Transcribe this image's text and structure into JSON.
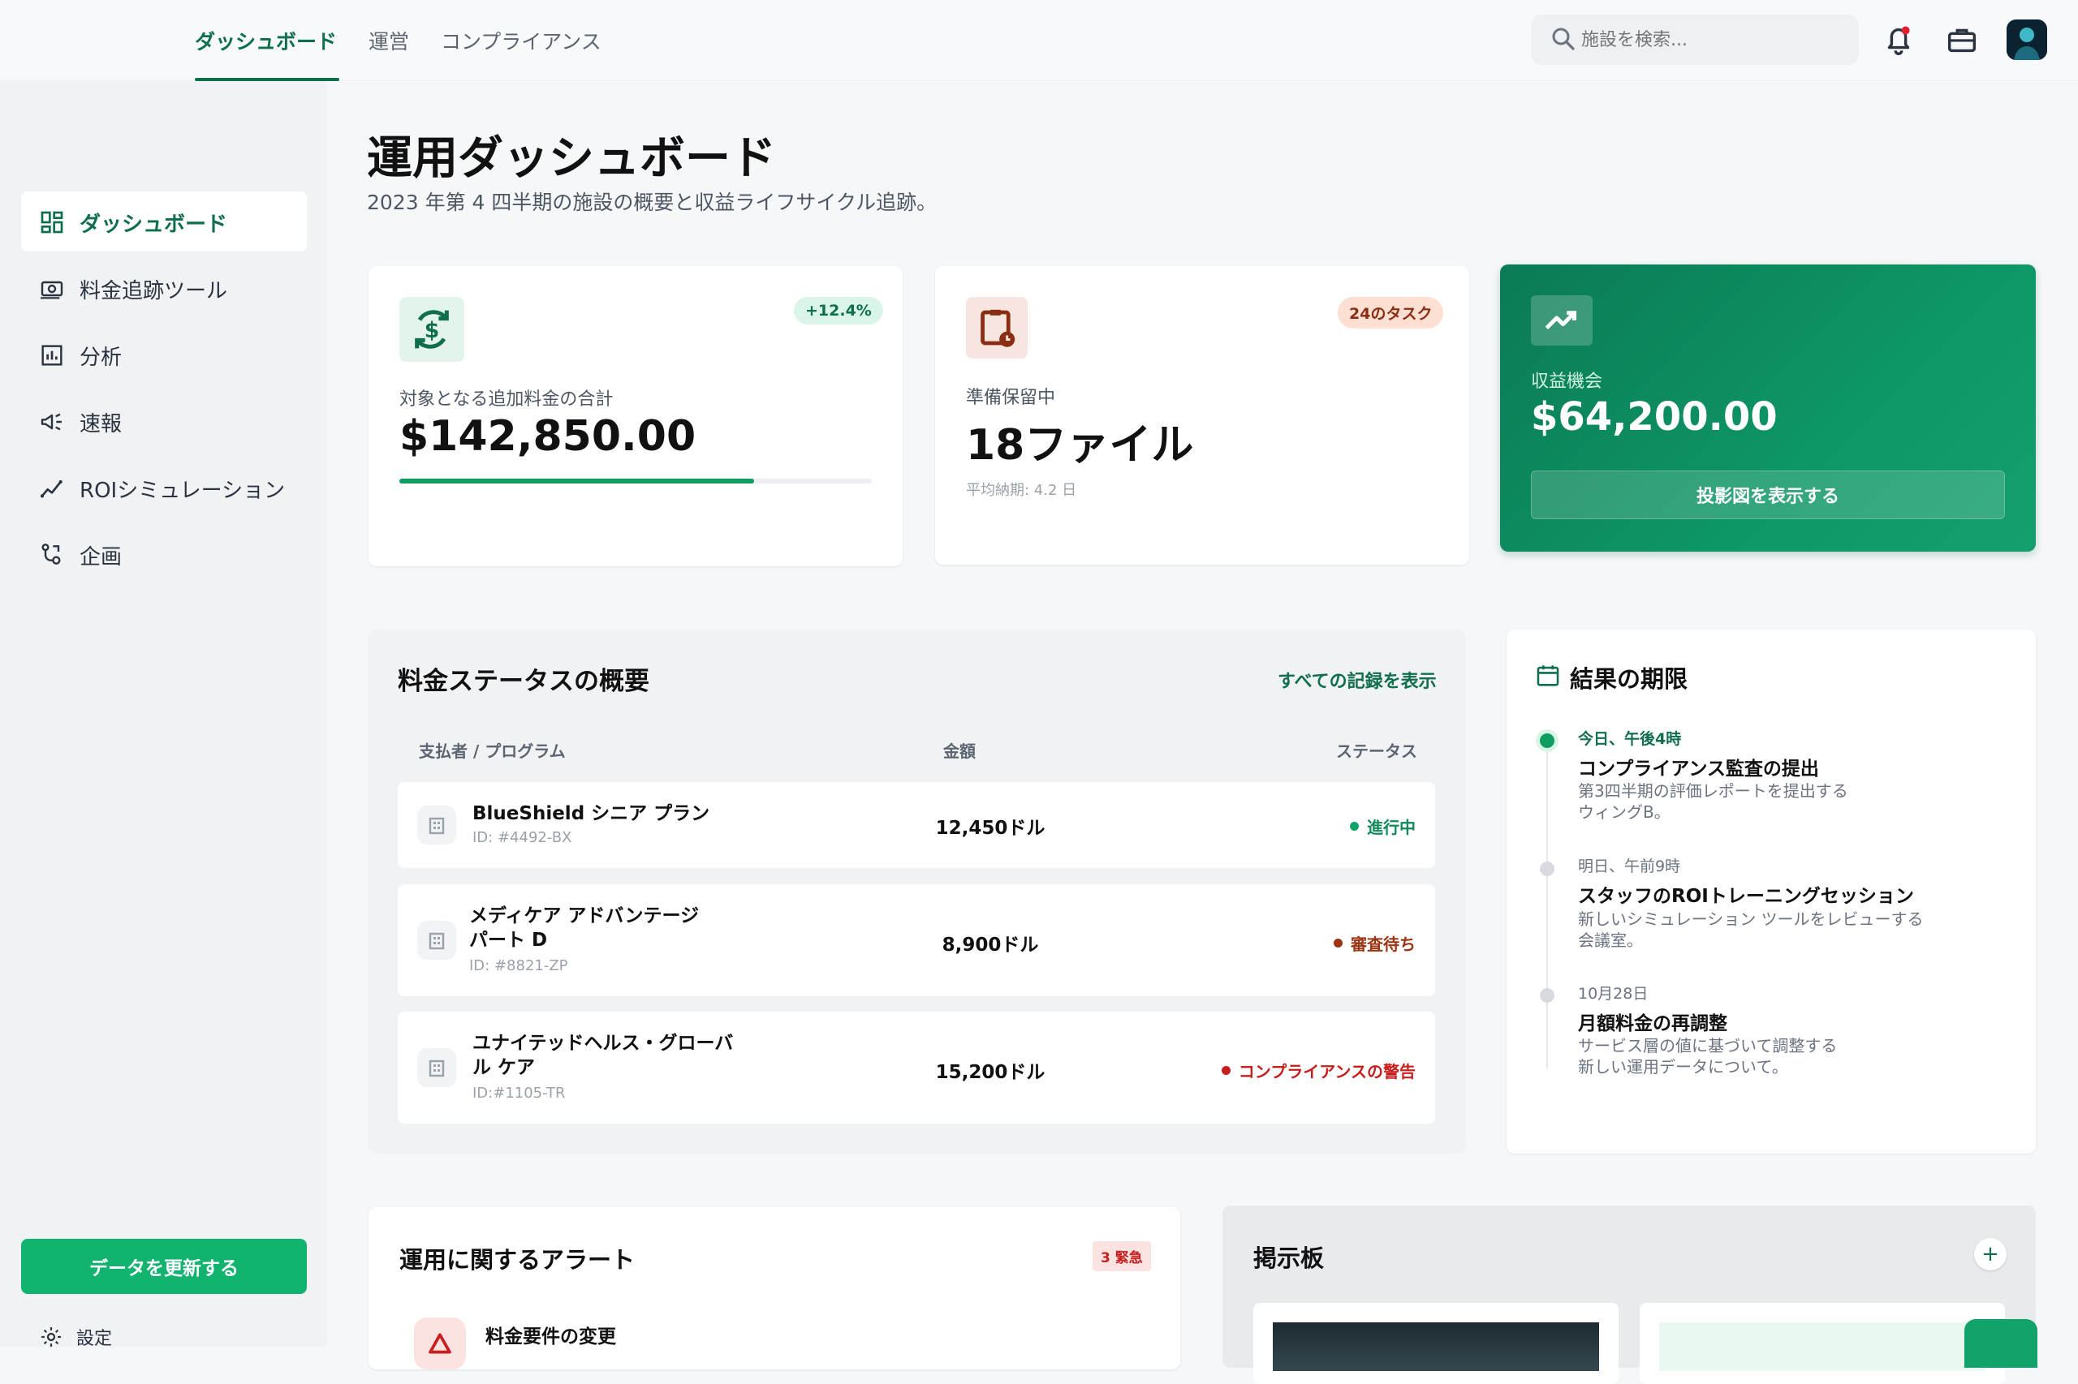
{
  "topnav": {
    "tabs": [
      {
        "label": "ダッシュボード",
        "active": true
      },
      {
        "label": "運営",
        "active": false
      },
      {
        "label": "コンプライアンス",
        "active": false
      }
    ],
    "search_placeholder": "施設を検索..."
  },
  "sidebar": {
    "items": [
      {
        "label": "ダッシュボード",
        "icon": "grid-icon",
        "active": true
      },
      {
        "label": "料金追跡ツール",
        "icon": "money-icon",
        "active": false
      },
      {
        "label": "分析",
        "icon": "bar-chart-icon",
        "active": false
      },
      {
        "label": "速報",
        "icon": "megaphone-icon",
        "active": false
      },
      {
        "label": "ROIシミュレーション",
        "icon": "trend-icon",
        "active": false
      },
      {
        "label": "企画",
        "icon": "strategy-icon",
        "active": false
      }
    ],
    "refresh_label": "データを更新する",
    "settings_label": "設定"
  },
  "page": {
    "title": "運用ダッシュボード",
    "subtitle": "2023 年第 4 四半期の施設の概要と収益ライフサイクル追跡。"
  },
  "kpis": {
    "charges": {
      "badge": "+12.4%",
      "label": "対象となる追加料金の合計",
      "value": "$142,850.00",
      "progress": 0.75
    },
    "prep": {
      "badge": "24のタスク",
      "label": "準備保留中",
      "value": "18ファイル",
      "meta": "平均納期: 4.2 日"
    },
    "revenue": {
      "label": "収益機会",
      "value": "$64,200.00",
      "button": "投影図を表示する"
    }
  },
  "status": {
    "title": "料金ステータスの概要",
    "view_all": "すべての記録を表示",
    "headers": {
      "payer": "支払者 / プログラム",
      "amount": "金額",
      "status": "ステータス"
    },
    "rows": [
      {
        "name": "BlueShield シニア プラン",
        "id": "ID: #4492-BX",
        "amount": "12,450ドル",
        "status": "進行中",
        "color": "#12a36a"
      },
      {
        "name": "メディケア アドバンテージ パート D",
        "id": "ID: #8821-ZP",
        "amount": "8,900ドル",
        "status": "審査待ち",
        "color": "#9a3412"
      },
      {
        "name": "ユナイテッドヘルス・グローバル ケア",
        "id": "ID:#1105-TR",
        "amount": "15,200ドル",
        "status": "コンプライアンスの警告",
        "color": "#c81e1e"
      }
    ]
  },
  "deadlines": {
    "title": "結果の期限",
    "items": [
      {
        "time": "今日、午後4時",
        "title": "コンプライアンス監査の提出",
        "desc1": "第3四半期の評価レポートを提出する",
        "desc2": "ウィングB。",
        "active": true
      },
      {
        "time": "明日、午前9時",
        "title": "スタッフのROIトレーニングセッション",
        "desc1": "新しいシミュレーション ツールをレビューする",
        "desc2": "会議室。",
        "active": false
      },
      {
        "time": "10月28日",
        "title": "月額料金の再調整",
        "desc1": "サービス層の値に基づいて調整する",
        "desc2": "新しい運用データについて。",
        "active": false
      }
    ]
  },
  "alerts": {
    "title": "運用に関するアラート",
    "badge": "3 緊急",
    "first_item": "料金要件の変更"
  },
  "board": {
    "title": "掲示板",
    "add_label": "+"
  },
  "colors": {
    "brand": "#0f6e4c",
    "accent": "#12b26f"
  }
}
